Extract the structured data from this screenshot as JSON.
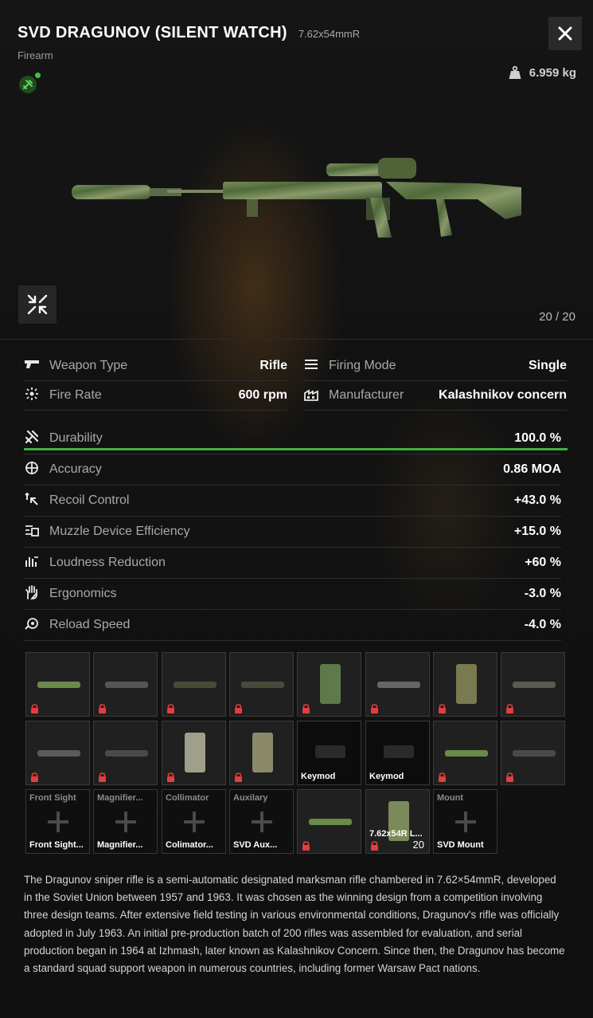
{
  "item": {
    "title": "SVD DRAGUNOV (SILENT WATCH)",
    "caliber": "7.62x54mmR",
    "category": "Firearm",
    "weight": "6.959 kg",
    "ammo": "20 / 20",
    "close_icon": "close-icon",
    "tool_icon": "repair-tools-icon",
    "weight_icon": "weight-icon",
    "collapse_icon": "collapse-icon",
    "status_color": "#38c838"
  },
  "specs": {
    "weapon_type": {
      "label": "Weapon Type",
      "value": "Rifle",
      "icon": "pistol-icon"
    },
    "firing_mode": {
      "label": "Firing Mode",
      "value": "Single",
      "icon": "firing-mode-icon"
    },
    "fire_rate": {
      "label": "Fire Rate",
      "value": "600 rpm",
      "icon": "fire-rate-icon"
    },
    "manufacturer": {
      "label": "Manufacturer",
      "value": "Kalashnikov concern",
      "icon": "factory-icon"
    }
  },
  "stats": [
    {
      "label": "Durability",
      "value": "100.0 %",
      "icon": "tools-icon",
      "fill": 1.0
    },
    {
      "label": "Accuracy",
      "value": "0.86 MOA",
      "icon": "crosshair-icon"
    },
    {
      "label": "Recoil Control",
      "value": "+43.0 %",
      "icon": "recoil-icon"
    },
    {
      "label": "Muzzle Device Efficiency",
      "value": "+15.0 %",
      "icon": "muzzle-icon"
    },
    {
      "label": "Loudness Reduction",
      "value": "+60 %",
      "icon": "loudness-icon"
    },
    {
      "label": "Ergonomics",
      "value": "-3.0 %",
      "icon": "hand-icon"
    },
    {
      "label": "Reload Speed",
      "value": "-4.0 %",
      "icon": "reload-icon"
    }
  ],
  "slots": [
    {
      "kind": "locked",
      "item": "handguard"
    },
    {
      "kind": "locked",
      "item": "mount"
    },
    {
      "kind": "locked",
      "item": "stock"
    },
    {
      "kind": "locked",
      "item": "stock"
    },
    {
      "kind": "locked",
      "item": "pistol-grip"
    },
    {
      "kind": "locked",
      "item": "barrel"
    },
    {
      "kind": "locked",
      "item": "scope-ring"
    },
    {
      "kind": "locked",
      "item": "rifle"
    },
    {
      "kind": "locked",
      "item": "tactical-device"
    },
    {
      "kind": "locked",
      "item": "scope"
    },
    {
      "kind": "locked",
      "item": "grip-block"
    },
    {
      "kind": "locked",
      "item": "vertical-grip"
    },
    {
      "kind": "dark",
      "bottom": "Keymod"
    },
    {
      "kind": "dark",
      "bottom": "Keymod"
    },
    {
      "kind": "locked",
      "item": "suppressor"
    },
    {
      "kind": "locked",
      "item": "scope"
    },
    {
      "kind": "empty",
      "top": "Front Sight",
      "bottom": "Front Sight..."
    },
    {
      "kind": "empty",
      "top": "Magnifier...",
      "bottom": "Magnifier..."
    },
    {
      "kind": "empty",
      "top": "Collimator",
      "bottom": "Colimator..."
    },
    {
      "kind": "empty",
      "top": "Auxilary",
      "bottom": "SVD Aux..."
    },
    {
      "kind": "locked",
      "item": "suppressor"
    },
    {
      "kind": "locked",
      "item": "magazine",
      "bottom": "7.62x54R L...",
      "count": "20"
    },
    {
      "kind": "empty",
      "top": "Mount",
      "bottom": "SVD Mount"
    }
  ],
  "description": "The Dragunov sniper rifle is a semi-automatic designated marksman rifle chambered in 7.62×54mmR, developed in the Soviet Union between 1957 and 1963. It was chosen as the winning design from a competition involving three design teams. After extensive field testing in various environmental conditions, Dragunov's rifle was officially adopted in July 1963. An initial pre-production batch of 200 rifles was assembled for evaluation, and serial production began in 1964 at Izhmash, later known as Kalashnikov Concern. Since then, the Dragunov has become a standard squad support weapon in numerous countries, including former Warsaw Pact nations."
}
